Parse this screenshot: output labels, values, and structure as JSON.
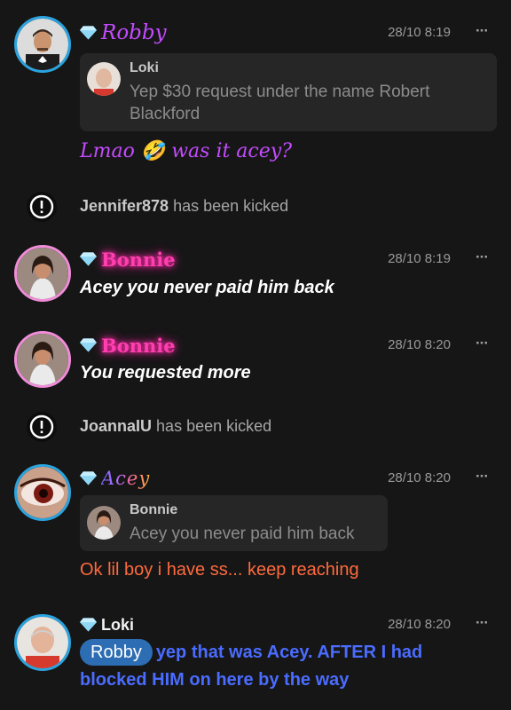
{
  "messages": [
    {
      "author": "Robby",
      "time": "28/10 8:19",
      "more": "···",
      "reply": {
        "author": "Loki",
        "text_line1": "Yep $30 request under the name Robert",
        "text_line2": "Blackford"
      },
      "text": "Lmao 🤣 was it acey?"
    },
    {
      "system": true,
      "user": "Jennifer878",
      "action": "has been kicked"
    },
    {
      "author": "Bonnie",
      "time": "28/10 8:19",
      "more": "···",
      "text": "Acey you never paid him back"
    },
    {
      "author": "Bonnie",
      "time": "28/10 8:20",
      "more": "···",
      "text": "You requested more"
    },
    {
      "system": true,
      "user": "JoannaIU",
      "action": "has been kicked"
    },
    {
      "author": "Acey",
      "time": "28/10 8:20",
      "more": "···",
      "reply": {
        "author": "Bonnie",
        "text_line1": "Acey you never paid him back"
      },
      "text": "Ok lil boy i have ss... keep reaching"
    },
    {
      "author": "Loki",
      "time": "28/10 8:20",
      "more": "···",
      "mention": "Robby",
      "text_line1": "yep that was Acey. AFTER I had",
      "text_line2": "blocked HIM on here by the way"
    }
  ],
  "colors": {
    "background": "#161616",
    "robby": "#c44bff",
    "bonnie": "#ff3fb0",
    "acey_text": "#ff6a3d",
    "loki_text": "#4a6cff",
    "mention_bg": "#2d6db3",
    "avatar_ring_blue": "#2aa3df",
    "avatar_ring_pink": "#f08cd8"
  },
  "icons": [
    "diamond-gem-icon",
    "more-options-icon",
    "exclamation-circle-icon"
  ]
}
